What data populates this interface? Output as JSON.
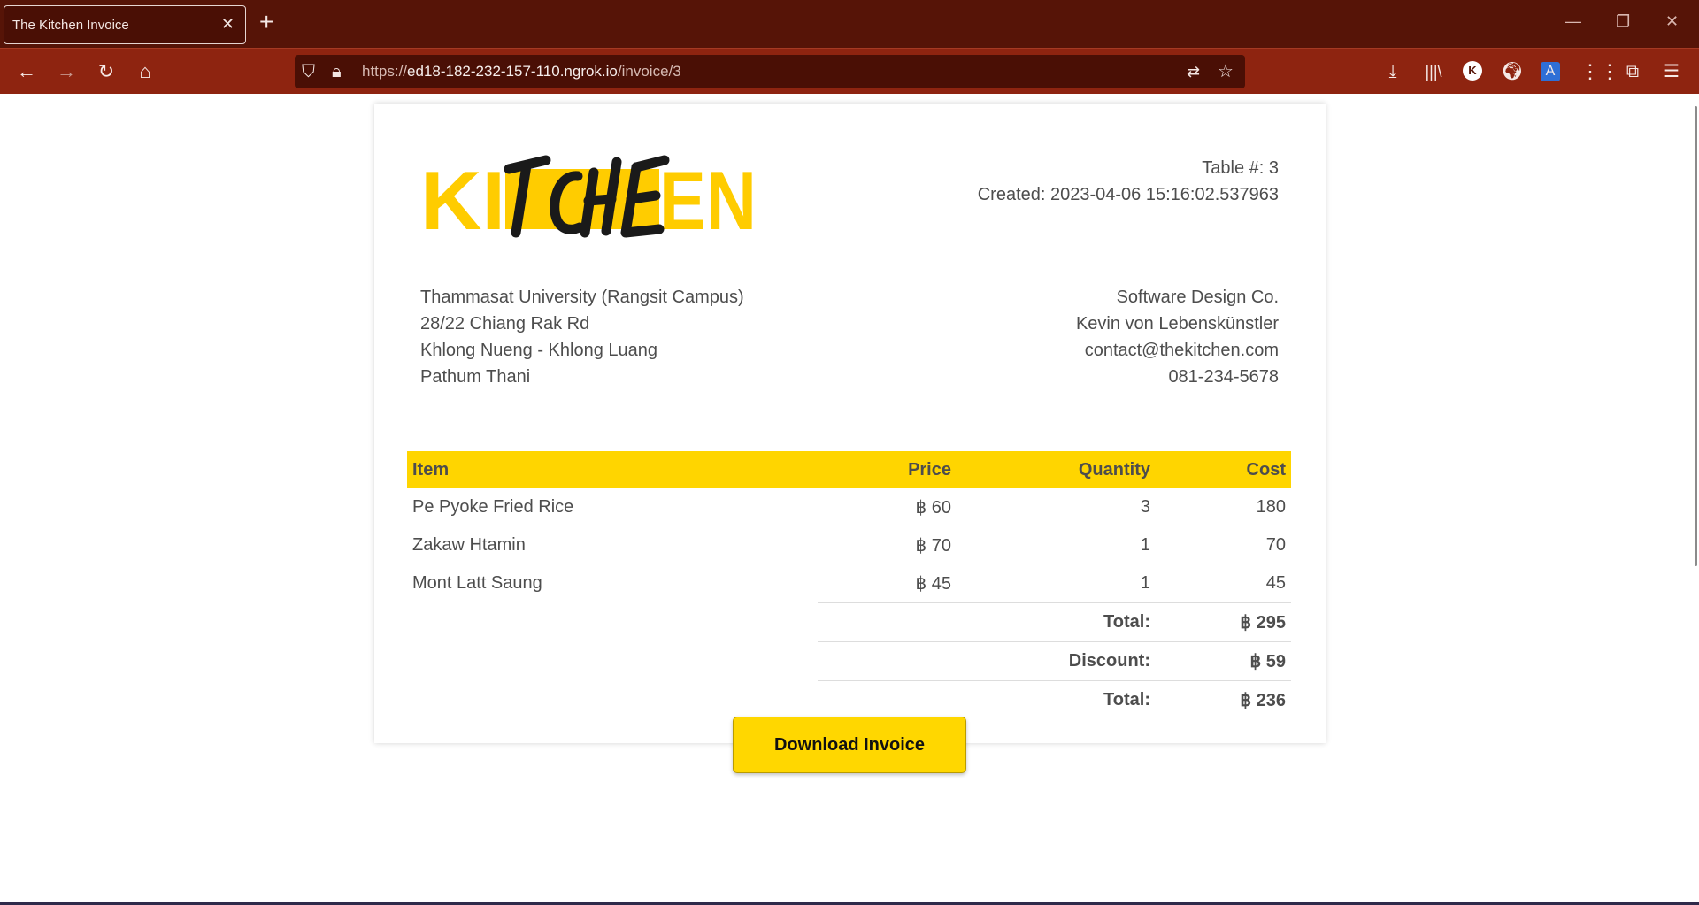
{
  "browser": {
    "tab_title": "The Kitchen Invoice",
    "url_prefix": "https://",
    "url_host": "ed18-182-232-157-110.ngrok.io",
    "url_path": "/invoice/3"
  },
  "invoice": {
    "logo": {
      "block_text": "KI  EN",
      "script_text": "TCHE"
    },
    "table_number": "Table #: 3",
    "created": "Created: 2023-04-06 15:16:02.537963",
    "from_address": [
      "Thammasat University (Rangsit Campus)",
      "28/22 Chiang Rak Rd",
      "Khlong Nueng - Khlong Luang",
      "Pathum Thani"
    ],
    "company": [
      "Software Design Co.",
      "Kevin von Lebenskünstler",
      "contact@thekitchen.com",
      "081-234-5678"
    ],
    "columns": {
      "item": "Item",
      "price": "Price",
      "quantity": "Quantity",
      "cost": "Cost"
    },
    "rows": [
      {
        "item": "Pe Pyoke Fried Rice",
        "price": "฿ 60",
        "quantity": "3",
        "cost": "180"
      },
      {
        "item": "Zakaw Htamin",
        "price": "฿ 70",
        "quantity": "1",
        "cost": "70"
      },
      {
        "item": "Mont Latt Saung",
        "price": "฿ 45",
        "quantity": "1",
        "cost": "45"
      }
    ],
    "summary": [
      {
        "label": "Total:",
        "value": "฿ 295"
      },
      {
        "label": "Discount:",
        "value": "฿ 59"
      },
      {
        "label": "Total:",
        "value": "฿ 236"
      }
    ]
  },
  "download_button": "Download Invoice",
  "colors": {
    "accent": "#ffd500",
    "chrome_dark": "#561407",
    "chrome_nav": "#8e2410"
  },
  "icons": [
    "back-icon",
    "forward-icon",
    "reload-icon",
    "home-icon",
    "shield-icon",
    "lock-icon",
    "translate-icon",
    "star-icon",
    "download-icon",
    "library-icon",
    "account-icon",
    "extension-globe-icon",
    "translate-ext-icon",
    "apps-grid-icon",
    "puzzle-icon",
    "menu-icon"
  ]
}
